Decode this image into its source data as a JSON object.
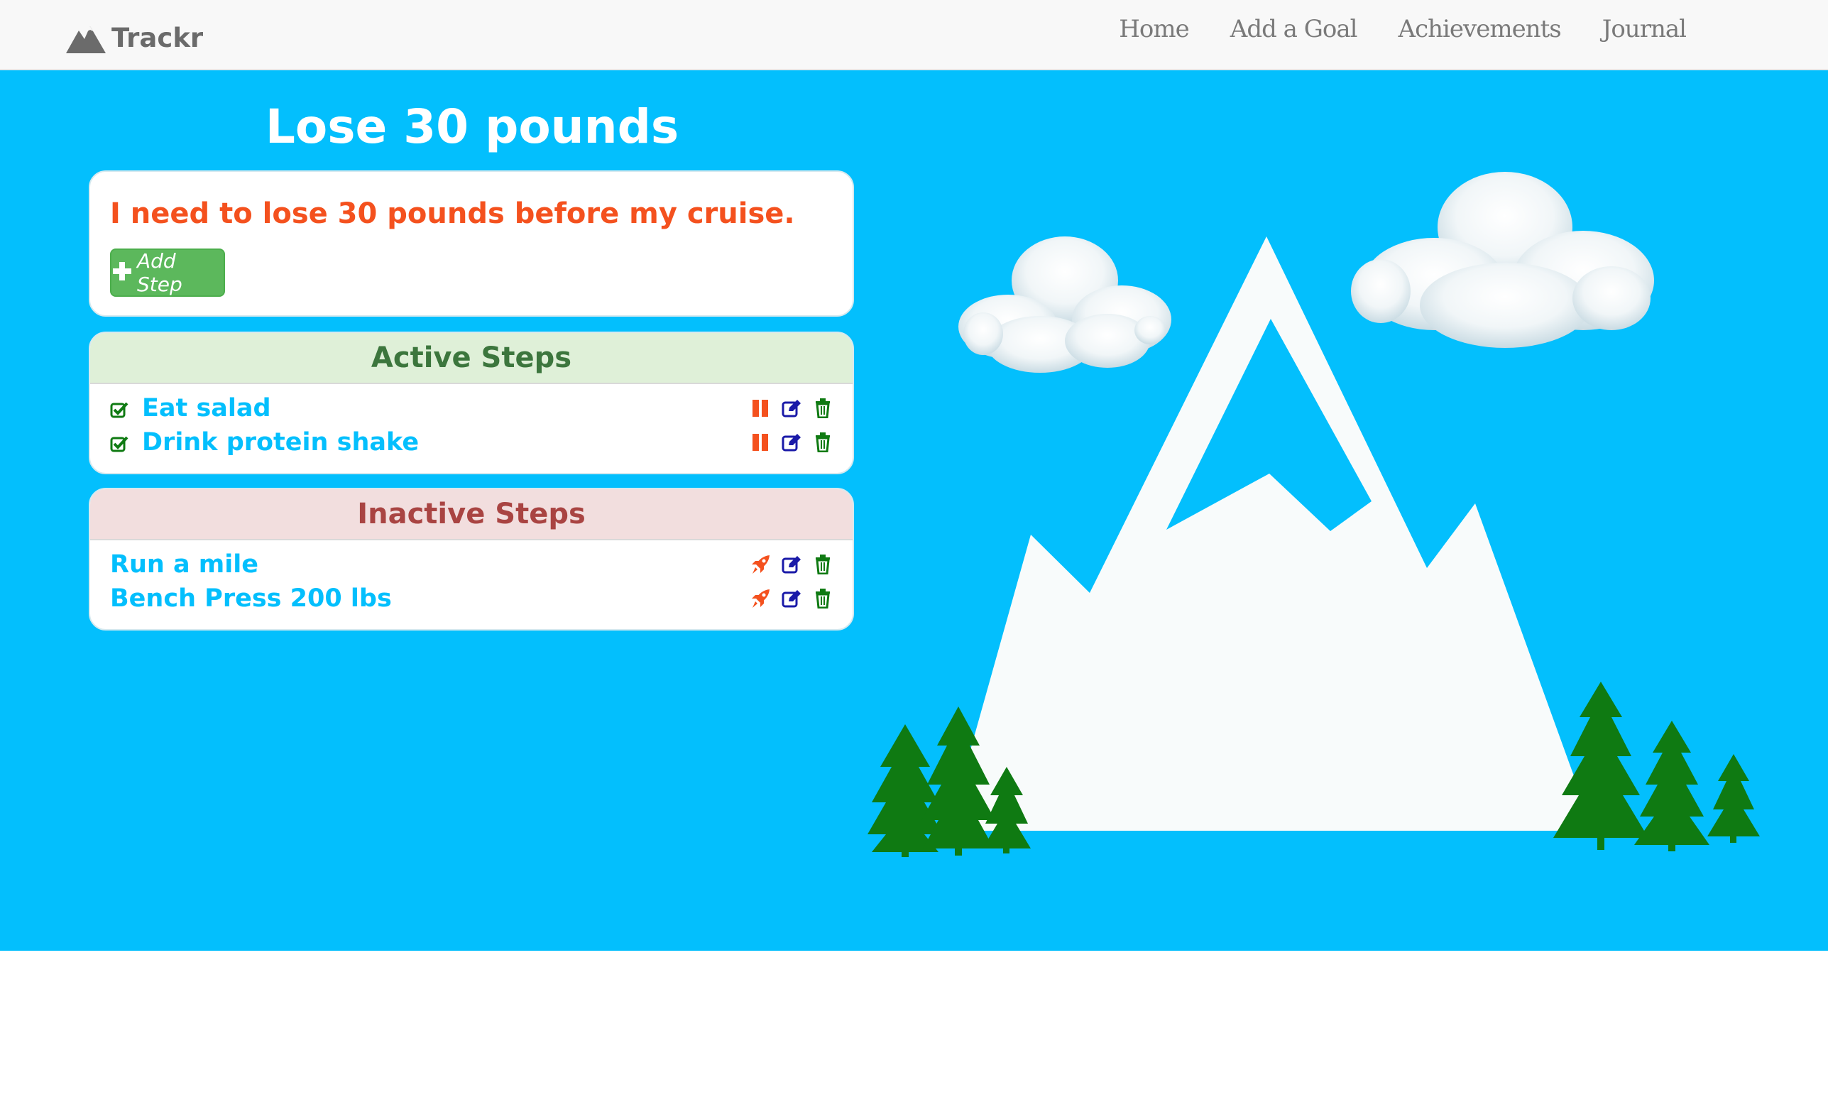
{
  "brand": {
    "name": "Trackr",
    "icon": "mountain-icon"
  },
  "nav": {
    "items": [
      {
        "label": "Home"
      },
      {
        "label": "Add a Goal"
      },
      {
        "label": "Achievements"
      },
      {
        "label": "Journal"
      }
    ]
  },
  "goal": {
    "title": "Lose 30 pounds",
    "description": "I need to lose 30 pounds before my cruise.",
    "add_step_label": "Add Step",
    "add_step_icon": "plus-icon"
  },
  "active_steps": {
    "header": "Active Steps",
    "items": [
      {
        "label": "Eat salad",
        "status_icon": "check-square-icon",
        "actions": [
          "pause-icon",
          "edit-icon",
          "trash-icon"
        ]
      },
      {
        "label": "Drink protein shake",
        "status_icon": "check-square-icon",
        "actions": [
          "pause-icon",
          "edit-icon",
          "trash-icon"
        ]
      }
    ]
  },
  "inactive_steps": {
    "header": "Inactive Steps",
    "items": [
      {
        "label": "Run a mile",
        "actions": [
          "rocket-icon",
          "edit-icon",
          "trash-icon"
        ]
      },
      {
        "label": "Bench Press 200 lbs",
        "actions": [
          "rocket-icon",
          "edit-icon",
          "trash-icon"
        ]
      }
    ]
  },
  "colors": {
    "hero_bg": "#03bffd",
    "accent_orange": "#f4511e",
    "success_green": "#5cb85c",
    "active_header_bg": "#dff0d8",
    "inactive_header_bg": "#f2dede",
    "tree_green": "#0f7a12",
    "edit_blue": "#1a1aa8"
  }
}
